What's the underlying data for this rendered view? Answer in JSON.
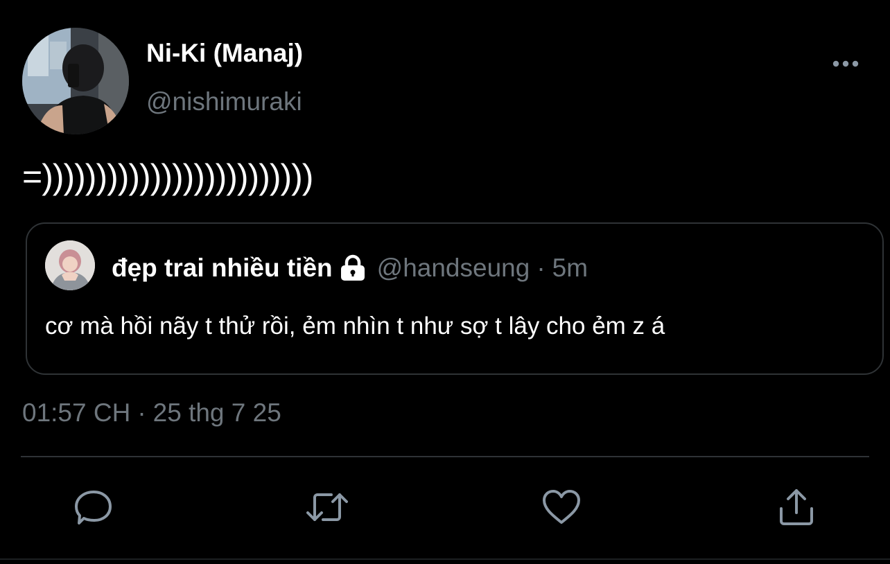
{
  "tweet": {
    "author": {
      "display_name": "Ni-Ki (Manaj)",
      "handle": "@nishimuraki"
    },
    "text": "=)))))))))))))))))))))))))",
    "timestamp": {
      "time": "01:57 CH",
      "separator": "·",
      "date": "25 thg 7 25"
    }
  },
  "quoted_tweet": {
    "display_name": "đẹp trai nhiều tiền",
    "protected_icon": "lock-icon",
    "handle": "@handseung",
    "separator": "·",
    "time_ago": "5m",
    "text": "cơ mà hồi nãy t thử rồi, ẻm nhìn t như sợ t lây cho ẻm z á"
  },
  "actions": [
    "reply-icon",
    "retweet-icon",
    "like-icon",
    "share-icon"
  ],
  "colors": {
    "background": "#000000",
    "primary_text": "#ffffff",
    "secondary_text": "#6e767d",
    "border": "#2f3336",
    "icon": "#8b98a5"
  }
}
